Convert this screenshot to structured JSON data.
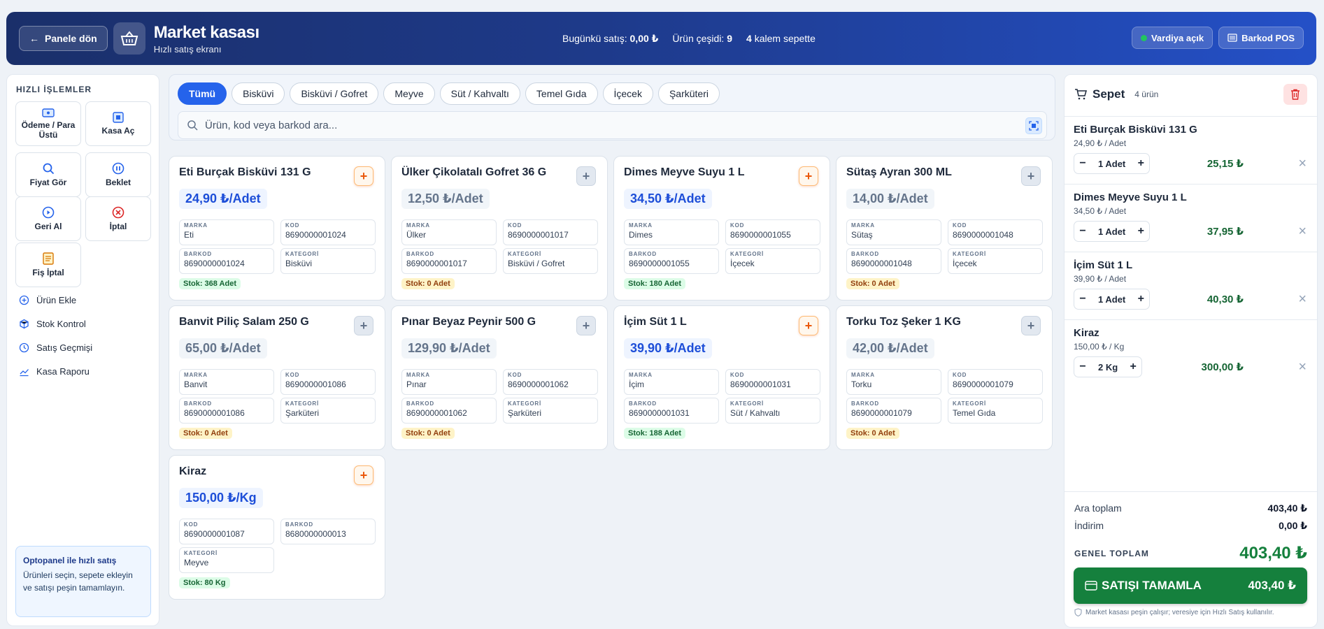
{
  "header": {
    "back_label": "Panele dön",
    "title": "Market kasası",
    "subtitle": "Hızlı satış ekranı",
    "stat_sales_label": "Bugünkü satış:",
    "stat_sales_value": "0,00 ₺",
    "stat_variety_label": "Ürün çeşidi:",
    "stat_variety_value": "9",
    "stat_cart_value": "4",
    "stat_cart_label": "kalem sepette",
    "shift_label": "Vardiya açık",
    "barcode_pos_label": "Barkod POS"
  },
  "sidebar": {
    "heading": "HIZLI İŞLEMLER",
    "quick": [
      {
        "label": "Ödeme / Para Üstü",
        "icon": "wallet-icon"
      },
      {
        "label": "Kasa Aç",
        "icon": "register-icon"
      },
      {
        "label": "Fiyat Gör",
        "icon": "search-icon"
      },
      {
        "label": "Beklet",
        "icon": "pause-icon"
      },
      {
        "label": "Geri Al",
        "icon": "play-icon"
      },
      {
        "label": "İptal",
        "icon": "cancel-icon"
      },
      {
        "label": "Fiş İptal",
        "icon": "receipt-icon"
      }
    ],
    "links": [
      {
        "label": "Ürün Ekle",
        "icon": "plus-circle-icon"
      },
      {
        "label": "Stok Kontrol",
        "icon": "box-icon"
      },
      {
        "label": "Satış Geçmişi",
        "icon": "clock-icon"
      },
      {
        "label": "Kasa Raporu",
        "icon": "chart-icon"
      }
    ],
    "tip_title": "Optopanel ile hızlı satış",
    "tip_text": "Ürünleri seçin, sepete ekleyin ve satışı peşin tamamlayın."
  },
  "categories": [
    "Tümü",
    "Bisküvi",
    "Bisküvi / Gofret",
    "Meyve",
    "Süt / Kahvaltı",
    "Temel Gıda",
    "İçecek",
    "Şarküteri"
  ],
  "active_category": "Tümü",
  "search": {
    "placeholder": "Ürün, kod veya barkod ara..."
  },
  "field_labels": {
    "brand": "MARKA",
    "code": "KOD",
    "barcode": "BARKOD",
    "category": "KATEGORİ"
  },
  "products": [
    {
      "name": "Eti Burçak Bisküvi 131 G",
      "price": "24,90 ₺/Adet",
      "brand": "Eti",
      "code": "8690000001024",
      "barcode": "8690000001024",
      "category": "Bisküvi",
      "stock": "Stok: 368 Adet",
      "in_stock": true
    },
    {
      "name": "Ülker Çikolatalı Gofret 36 G",
      "price": "12,50 ₺/Adet",
      "brand": "Ülker",
      "code": "8690000001017",
      "barcode": "8690000001017",
      "category": "Bisküvi / Gofret",
      "stock": "Stok: 0 Adet",
      "in_stock": false
    },
    {
      "name": "Dimes Meyve Suyu 1 L",
      "price": "34,50 ₺/Adet",
      "brand": "Dimes",
      "code": "8690000001055",
      "barcode": "8690000001055",
      "category": "İçecek",
      "stock": "Stok: 180 Adet",
      "in_stock": true
    },
    {
      "name": "Sütaş Ayran 300 ML",
      "price": "14,00 ₺/Adet",
      "brand": "Sütaş",
      "code": "8690000001048",
      "barcode": "8690000001048",
      "category": "İçecek",
      "stock": "Stok: 0 Adet",
      "in_stock": false
    },
    {
      "name": "Banvit Piliç Salam 250 G",
      "price": "65,00 ₺/Adet",
      "brand": "Banvit",
      "code": "8690000001086",
      "barcode": "8690000001086",
      "category": "Şarküteri",
      "stock": "Stok: 0 Adet",
      "in_stock": false
    },
    {
      "name": "Pınar Beyaz Peynir 500 G",
      "price": "129,90 ₺/Adet",
      "brand": "Pınar",
      "code": "8690000001062",
      "barcode": "8690000001062",
      "category": "Şarküteri",
      "stock": "Stok: 0 Adet",
      "in_stock": false
    },
    {
      "name": "İçim Süt 1 L",
      "price": "39,90 ₺/Adet",
      "brand": "İçim",
      "code": "8690000001031",
      "barcode": "8690000001031",
      "category": "Süt / Kahvaltı",
      "stock": "Stok: 188 Adet",
      "in_stock": true
    },
    {
      "name": "Torku Toz Şeker 1 KG",
      "price": "42,00 ₺/Adet",
      "brand": "Torku",
      "code": "8690000001079",
      "barcode": "8690000001079",
      "category": "Temel Gıda",
      "stock": "Stok: 0 Adet",
      "in_stock": false
    },
    {
      "name": "Kiraz",
      "price": "150,00 ₺/Kg",
      "code": "8690000001087",
      "barcode": "8680000000013",
      "category": "Meyve",
      "stock": "Stok: 80 Kg",
      "in_stock": true
    }
  ],
  "cart": {
    "title": "Sepet",
    "count": "4 ürün",
    "items": [
      {
        "name": "Eti Burçak Bisküvi 131 G",
        "unit": "24,90 ₺ / Adet",
        "qty": "1 Adet",
        "total": "25,15 ₺"
      },
      {
        "name": "Dimes Meyve Suyu 1 L",
        "unit": "34,50 ₺ / Adet",
        "qty": "1 Adet",
        "total": "37,95 ₺"
      },
      {
        "name": "İçim Süt 1 L",
        "unit": "39,90 ₺ / Adet",
        "qty": "1 Adet",
        "total": "40,30 ₺"
      },
      {
        "name": "Kiraz",
        "unit": "150,00 ₺ / Kg",
        "qty": "2 Kg",
        "total": "300,00 ₺"
      }
    ],
    "subtotal_label": "Ara toplam",
    "subtotal": "403,40 ₺",
    "discount_label": "İndirim",
    "discount": "0,00 ₺",
    "grand_label": "GENEL TOPLAM",
    "grand_total": "403,40 ₺",
    "finish_label": "SATIŞI TAMAMLA",
    "finish_total": "403,40 ₺",
    "note": "Market kasası peşin çalışır; veresiye için Hızlı Satış kullanılır."
  },
  "colors": {
    "accent": "#2563eb",
    "success": "#15803d",
    "warning": "#ea580c",
    "danger": "#dc2626"
  }
}
